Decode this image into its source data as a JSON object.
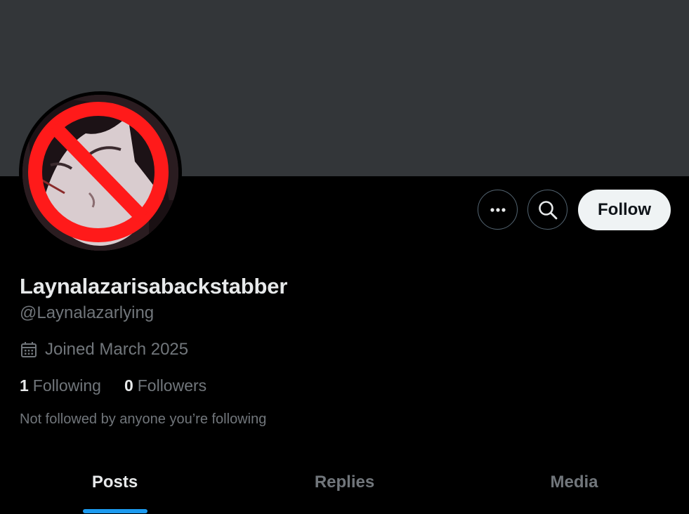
{
  "profile": {
    "display_name": "Laynalazarisabackstabber",
    "handle": "@Laynalazarlying",
    "joined": "Joined March 2025",
    "following_count": "1",
    "following_label": "Following",
    "followers_count": "0",
    "followers_label": "Followers",
    "not_followed_text": "Not followed by anyone you’re following"
  },
  "actions": {
    "follow_label": "Follow",
    "more_icon": "more-horizontal-icon",
    "search_icon": "search-icon"
  },
  "tabs": [
    {
      "label": "Posts",
      "active": true
    },
    {
      "label": "Replies",
      "active": false
    },
    {
      "label": "Media",
      "active": false
    }
  ],
  "colors": {
    "banner": "#333639",
    "background": "#000000",
    "accent": "#1d9bf0",
    "primary_text": "#e7e9ea",
    "secondary_text": "#71767b",
    "prohibition_red": "#ff1a1a"
  }
}
